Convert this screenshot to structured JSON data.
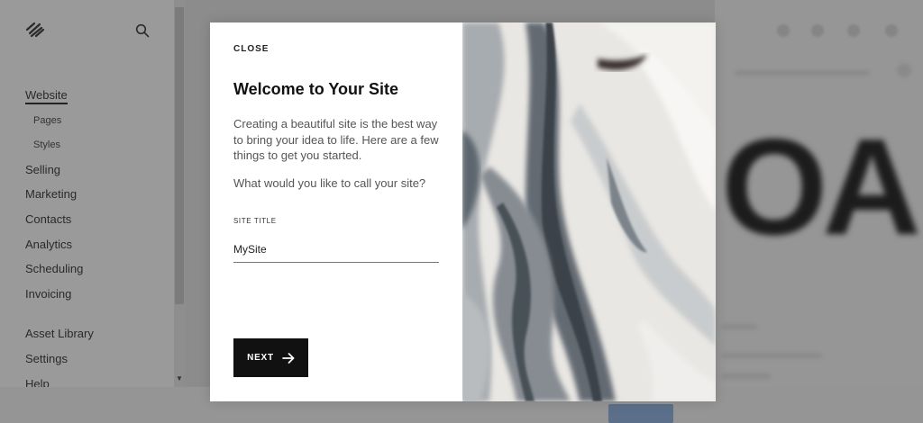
{
  "sidebar": {
    "logo_icon": "squarespace-logo-icon",
    "search_icon": "search-icon",
    "nav": {
      "website": "Website",
      "pages": "Pages",
      "styles": "Styles",
      "selling": "Selling",
      "marketing": "Marketing",
      "contacts": "Contacts",
      "analytics": "Analytics",
      "scheduling": "Scheduling",
      "invoicing": "Invoicing",
      "asset_library": "Asset Library",
      "settings": "Settings",
      "help": "Help"
    }
  },
  "preview": {
    "big_text": "OA"
  },
  "modal": {
    "close_label": "CLOSE",
    "title": "Welcome to Your Site",
    "description": "Creating a beautiful site is the best way to bring your idea to life. Here are a few things to get you started.",
    "question": "What would you like to call your site?",
    "field_label": "SITE TITLE",
    "field_value": "MySite",
    "next_label": "NEXT",
    "next_icon": "arrow-right-icon",
    "image": "marble-texture-image"
  },
  "colors": {
    "overlay": "#8c8c8c",
    "modal_bg": "#ffffff",
    "button_bg": "#111111"
  }
}
